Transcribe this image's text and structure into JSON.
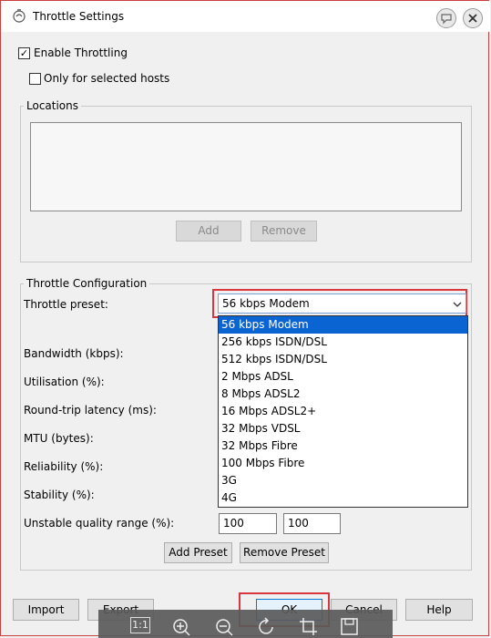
{
  "window": {
    "title": "Throttle Settings"
  },
  "checkboxes": {
    "enable_throttling": {
      "label": "Enable Throttling",
      "checked_glyph": "✓"
    },
    "only_selected_hosts": {
      "label": "Only for selected hosts"
    }
  },
  "locations": {
    "title": "Locations",
    "add_label": "Add",
    "remove_label": "Remove"
  },
  "throttle_config": {
    "title": "Throttle Configuration",
    "preset_label": "Throttle preset:",
    "preset_value": "56 kbps Modem",
    "fields": [
      "Bandwidth (kbps):",
      "Utilisation (%):",
      "Round-trip latency (ms):",
      "MTU (bytes):",
      "Reliability (%):",
      "Stability (%):",
      "Unstable quality range (%):"
    ],
    "unstable_min": "100",
    "unstable_max": "100",
    "add_preset_label": "Add Preset",
    "remove_preset_label": "Remove Preset"
  },
  "dropdown_options": [
    "56 kbps Modem",
    "256 kbps ISDN/DSL",
    "512 kbps ISDN/DSL",
    "2 Mbps ADSL",
    "8 Mbps ADSL2",
    "16 Mbps ADSL2+",
    "32 Mbps VDSL",
    "32 Mbps Fibre",
    "100 Mbps Fibre",
    "3G",
    "4G"
  ],
  "footer": {
    "import_label": "Import",
    "export_label": "Export",
    "ok_label": "OK",
    "cancel_label": "Cancel",
    "help_label": "Help"
  },
  "overlay_toolbar": {
    "actual_size_label": "1:1",
    "icons": [
      "actual-size-icon",
      "zoom-in-icon",
      "zoom-out-icon",
      "rotate-icon",
      "crop-icon",
      "save-icon"
    ]
  },
  "colors": {
    "selection": "#0a64d2",
    "highlight_outline": "#d9363e"
  }
}
